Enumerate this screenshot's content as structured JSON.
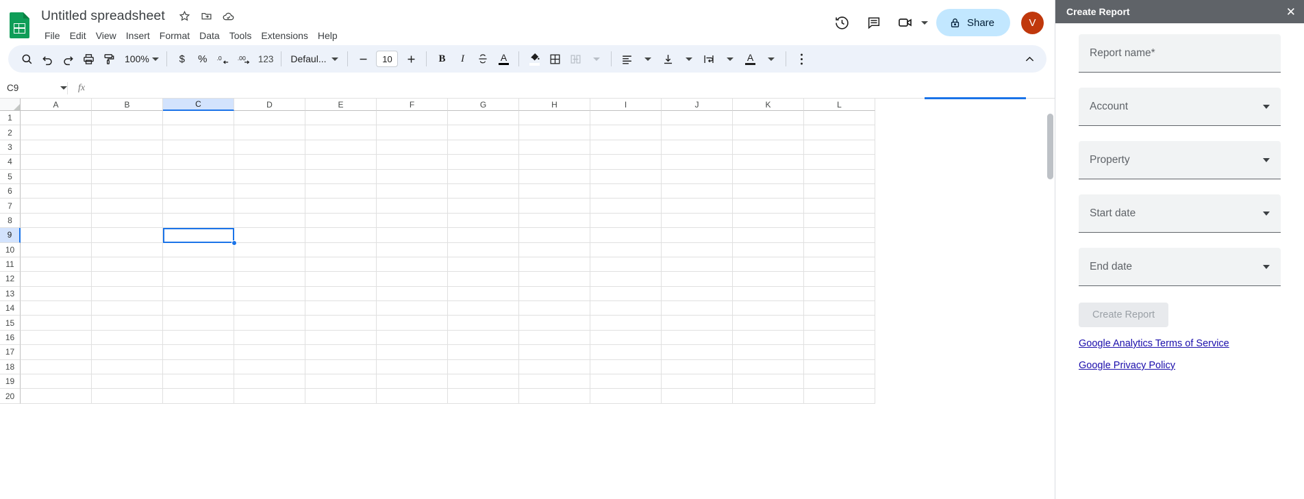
{
  "app": {
    "doc_title": "Untitled spreadsheet",
    "title_icons": [
      "star-icon",
      "move-to-folder-icon",
      "cloud-saved-icon"
    ],
    "menus": [
      "File",
      "Edit",
      "View",
      "Insert",
      "Format",
      "Data",
      "Tools",
      "Extensions",
      "Help"
    ],
    "header_actions": {
      "history_icon": "version-history-icon",
      "comment_icon": "comment-icon",
      "meet_icon": "video-call-icon",
      "share_label": "Share",
      "share_lock_icon": "lock-icon",
      "avatar_initial": "V",
      "avatar_color": "#c0380c"
    }
  },
  "toolbar": {
    "zoom_level": "100%",
    "font_name": "Defaul...",
    "font_size": "10",
    "number_format": "123",
    "items": [
      "search-icon",
      "undo-icon",
      "redo-icon",
      "print-icon",
      "paint-format-icon",
      "currency-icon",
      "percent-icon",
      "decrease-decimal-icon",
      "increase-decimal-icon",
      "bold-icon",
      "italic-icon",
      "strikethrough-icon",
      "text-color-icon",
      "fill-color-icon",
      "borders-icon",
      "merge-cells-icon",
      "horizontal-align-icon",
      "vertical-align-icon",
      "text-wrap-icon",
      "text-rotation-icon",
      "more-options-icon",
      "collapse-toolbar-icon"
    ],
    "currency_symbol": "$",
    "percent_symbol": "%",
    "bold_label": "B",
    "italic_label": "I",
    "text_color_label": "A",
    "decimal_decrease_label": ".0",
    "decimal_increase_label": ".00"
  },
  "formula_bar": {
    "cell_reference": "C9",
    "fx_label": "fx",
    "formula_value": ""
  },
  "grid": {
    "columns": [
      "A",
      "B",
      "C",
      "D",
      "E",
      "F",
      "G",
      "H",
      "I",
      "J",
      "K",
      "L"
    ],
    "rows": [
      "1",
      "2",
      "3",
      "4",
      "5",
      "6",
      "7",
      "8",
      "9",
      "10",
      "11",
      "12",
      "13",
      "14",
      "15",
      "16",
      "17",
      "18",
      "19",
      "20"
    ],
    "active_column": "C",
    "active_row": "9",
    "selected_cell": "C9",
    "selection_color": "#1a73e8",
    "header_highlight_color": "#d3e3fd"
  },
  "sidebar": {
    "title": "Create Report",
    "close_icon": "close-icon",
    "header_color": "#5f6368",
    "fields": [
      {
        "label": "Report name*",
        "type": "text"
      },
      {
        "label": "Account",
        "type": "select"
      },
      {
        "label": "Property",
        "type": "select"
      },
      {
        "label": "Start date",
        "type": "select"
      },
      {
        "label": "End date",
        "type": "select"
      }
    ],
    "submit_label": "Create Report",
    "submit_disabled": true,
    "links": [
      "Google Analytics Terms of Service",
      "Google Privacy Policy"
    ],
    "link_color": "#1a0dab"
  }
}
